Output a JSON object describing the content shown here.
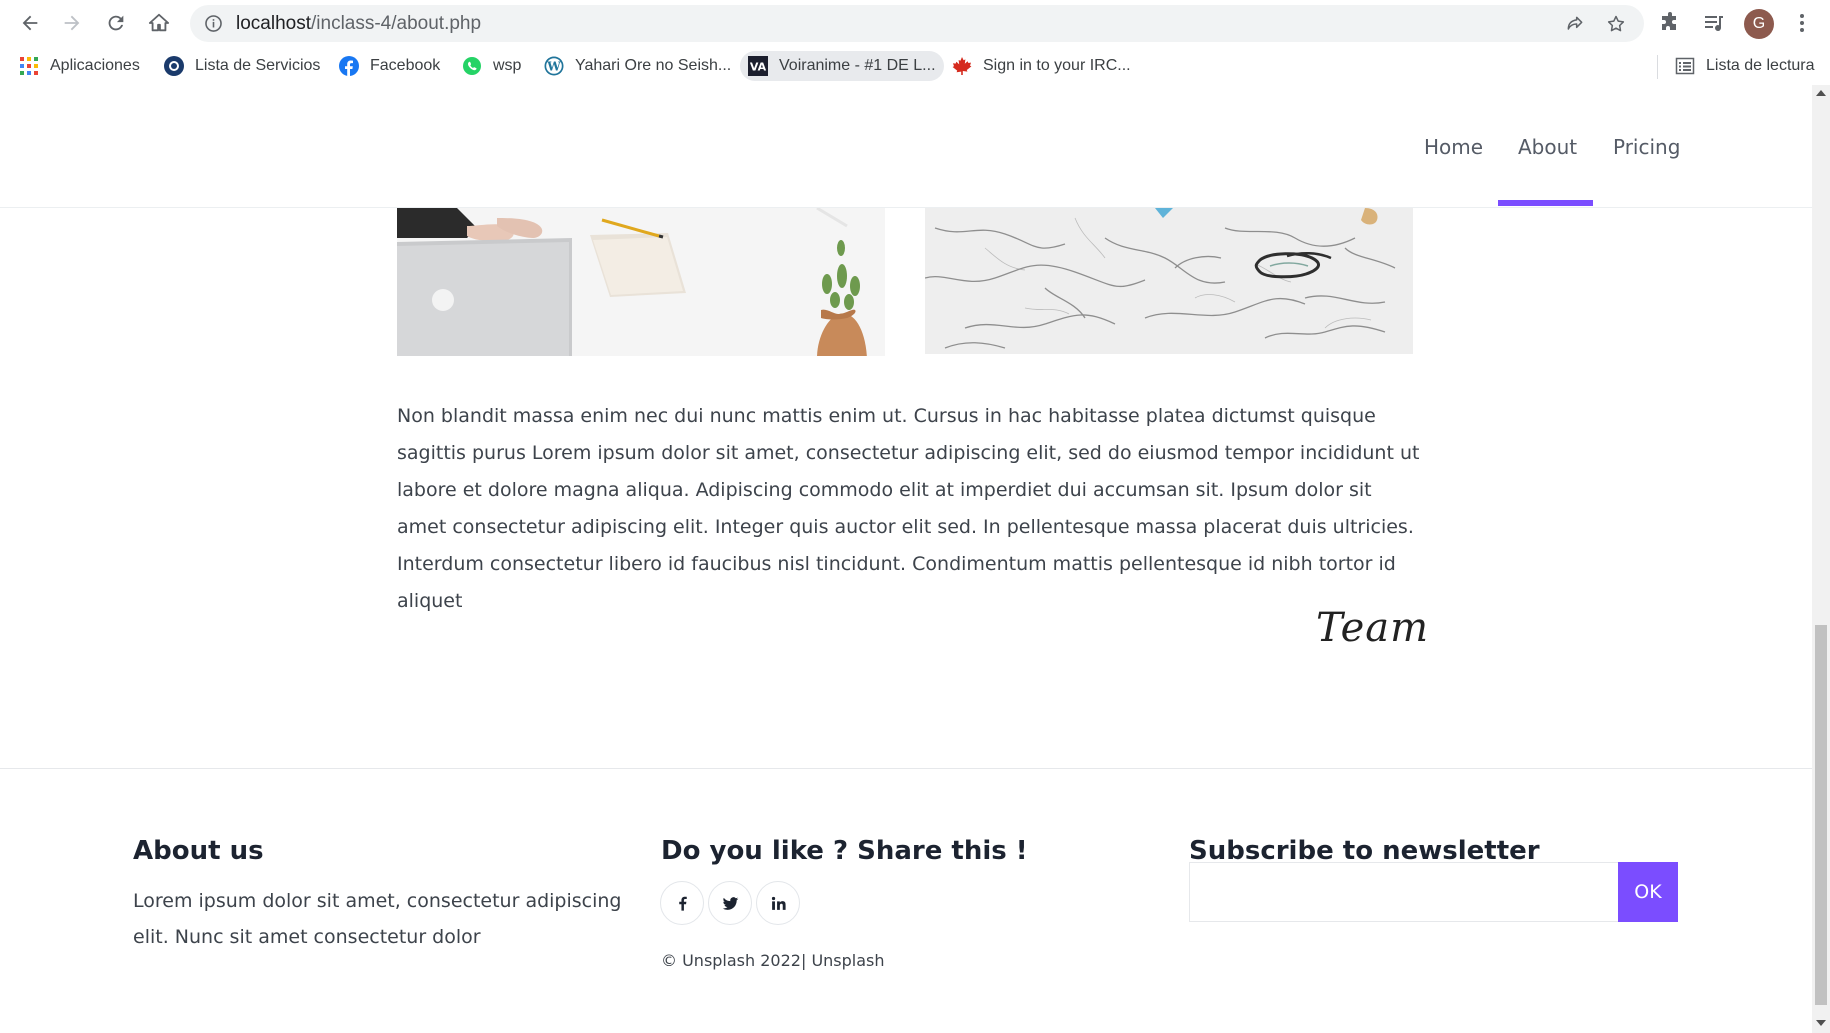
{
  "browser": {
    "url_host": "localhost",
    "url_path": "/inclass-4/about.php",
    "avatar_letter": "G",
    "bookmarks": [
      {
        "label": "Aplicaciones",
        "icon": "apps-grid-icon"
      },
      {
        "label": "Lista de Servicios",
        "icon": "services-icon"
      },
      {
        "label": "Facebook",
        "icon": "facebook-icon"
      },
      {
        "label": "wsp",
        "icon": "whatsapp-icon"
      },
      {
        "label": "Yahari Ore no Seish...",
        "icon": "wordpress-icon"
      },
      {
        "label": "Voiranime - #1 DE L...",
        "icon": "voiranime-icon"
      },
      {
        "label": "Sign in to your IRC...",
        "icon": "maple-leaf-icon"
      }
    ],
    "reading_list": "Lista de lectura"
  },
  "site": {
    "nav": [
      {
        "label": "Home"
      },
      {
        "label": "About"
      },
      {
        "label": "Pricing"
      }
    ],
    "active_nav": "About",
    "accent_color": "#7b4dff",
    "body_paragraph": "Non blandit massa enim nec dui nunc mattis enim ut. Cursus in hac habitasse platea dictumst quisque sagittis purus Lorem ipsum dolor sit amet, consectetur adipiscing elit, sed do eiusmod tempor incididunt ut labore et dolore magna aliqua. Adipiscing commodo elit at imperdiet dui accumsan sit. Ipsum dolor sit amet consectetur adipiscing elit. Integer quis auctor elit sed. In pellentesque massa placerat duis ultricies. Interdum consectetur libero id faucibus nisl tincidunt. Condimentum mattis pellentesque id nibh tortor id aliquet",
    "signature": "Team"
  },
  "footer": {
    "about_title": "About us",
    "about_text": "Lorem ipsum dolor sit amet, consectetur adipiscing elit. Nunc sit amet consectetur dolor",
    "share_title": "Do you like ? Share this !",
    "social": [
      "facebook-icon",
      "twitter-icon",
      "linkedin-icon"
    ],
    "copyright": "© Unsplash 2022| Unsplash",
    "newsletter_title": "Subscribe to newsletter",
    "newsletter_placeholder": "",
    "newsletter_button": "OK"
  }
}
